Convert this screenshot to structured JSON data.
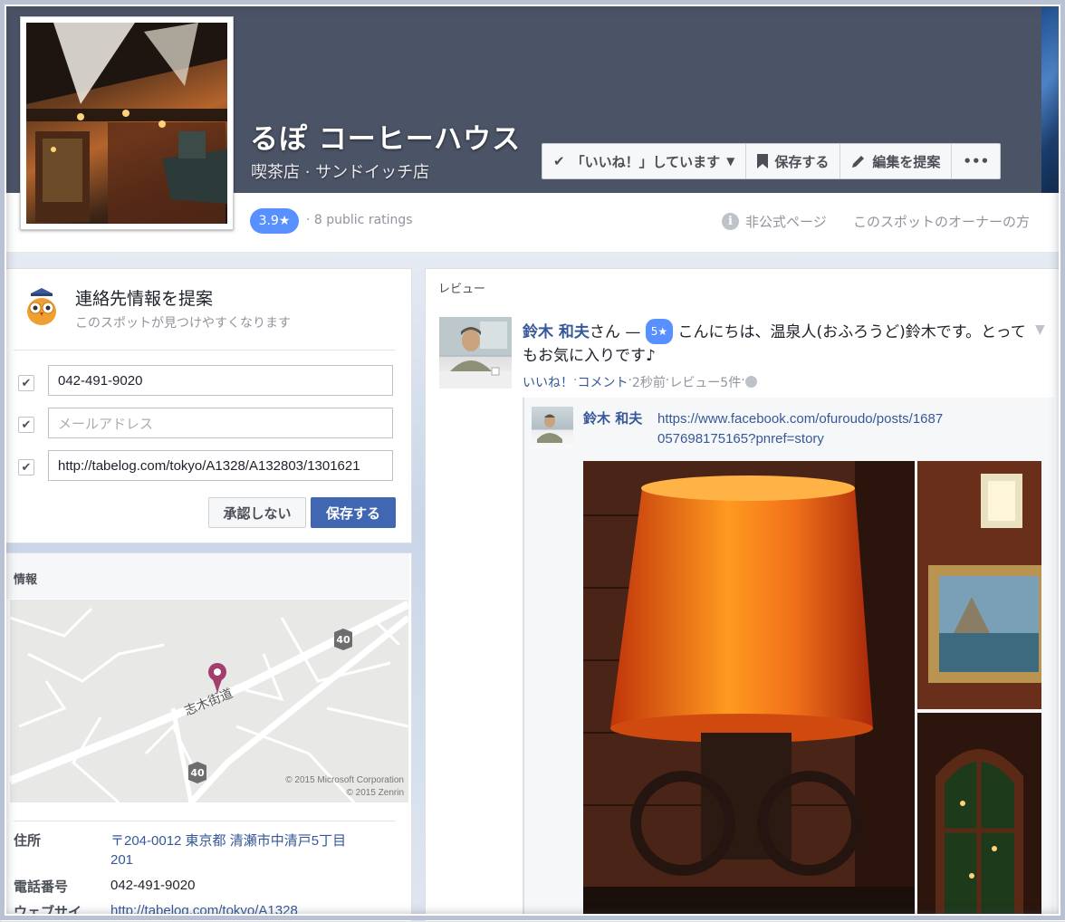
{
  "page": {
    "name": "るぽ コーヒーハウス",
    "categories": "喫茶店 · サンドイッチ店",
    "rating": "3.9★",
    "ratings_count": "· 8 public ratings",
    "unofficial": "非公式ページ",
    "owner_link": "このスポットのオーナーの方"
  },
  "actions": {
    "liked": "「いいね！」しています",
    "save": "保存する",
    "suggest_edit": "編集を提案",
    "more": "•••"
  },
  "contact_card": {
    "title": "連絡先情報を提案",
    "subtitle": "このスポットが見つけやすくなります",
    "fields": [
      {
        "value": "042-491-9020",
        "placeholder": ""
      },
      {
        "value": "",
        "placeholder": "メールアドレス"
      },
      {
        "value": "http://tabelog.com/tokyo/A1328/A132803/1301621",
        "placeholder": ""
      }
    ],
    "decline": "承認しない",
    "save": "保存する"
  },
  "info_card": {
    "heading": "情報",
    "map": {
      "road_label": "志木街道",
      "route_number": "40",
      "copyright1": "© 2015 Microsoft Corporation",
      "copyright2": "© 2015 Zenrin"
    },
    "address_label": "住所",
    "address_line1": "〒204-0012 東京都 清瀬市中清戸5丁目",
    "address_line2": "201",
    "phone_label": "電話番号",
    "phone": "042-491-9020",
    "website_label": "ウェブサイ",
    "website": "http://tabelog.com/tokyo/A1328"
  },
  "reviews": {
    "heading": "レビュー",
    "author": "鈴木 和夫",
    "suffix": "さん — ",
    "stars": "5★",
    "text": " こんにちは、温泉人(おふろうど)鈴木です。とってもお気に入りです♪",
    "like": "いいね！",
    "comment": "コメント",
    "time": "2秒前",
    "review_count": "レビュー5件",
    "sep": " · ",
    "shared_author": "鈴木 和夫",
    "shared_link": "https://www.facebook.com/ofuroudo/posts/1687057698175165?pnref=story"
  }
}
